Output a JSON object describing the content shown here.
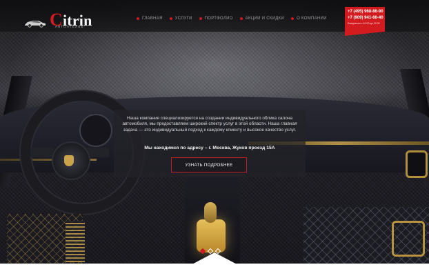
{
  "brand": {
    "name_initial": "C",
    "name_rest": "itrin",
    "tagline": "АВТОАТЕЛЬЕ"
  },
  "nav": {
    "items": [
      {
        "label": "ГЛАВНАЯ"
      },
      {
        "label": "УСЛУГИ"
      },
      {
        "label": "ПОРТФОЛИО"
      },
      {
        "label": "АКЦИИ И СКИДКИ"
      },
      {
        "label": "О КОМПАНИИ"
      }
    ]
  },
  "contacts": {
    "phone_1": "+7 (495) 968-86-90",
    "phone_2": "+7 (909) 941-66-40",
    "hours": "Ежедневно с 10:00 до 22:00"
  },
  "hero": {
    "description": "Наша компания специализируется на создании индивидуального облика салона автомобиля, мы предоставляем широкий спектр услуг в этой области. Наша главная задача — это индивидуальный подход к каждому клиенту и высокое качество услуг.",
    "address": "Мы находимся по адресу – г. Москва, Жуков проезд 15А",
    "cta_label": "УЗНАТЬ ПОДРОБНЕЕ"
  },
  "slider": {
    "active_index": 0,
    "count": 3
  },
  "colors": {
    "accent": "#d21b1e",
    "gold": "#c9a24b",
    "text_light": "#dcdcdc"
  },
  "icons": [
    "car-logo-icon",
    "nav-bullet-icon",
    "slider-dot-icon"
  ]
}
